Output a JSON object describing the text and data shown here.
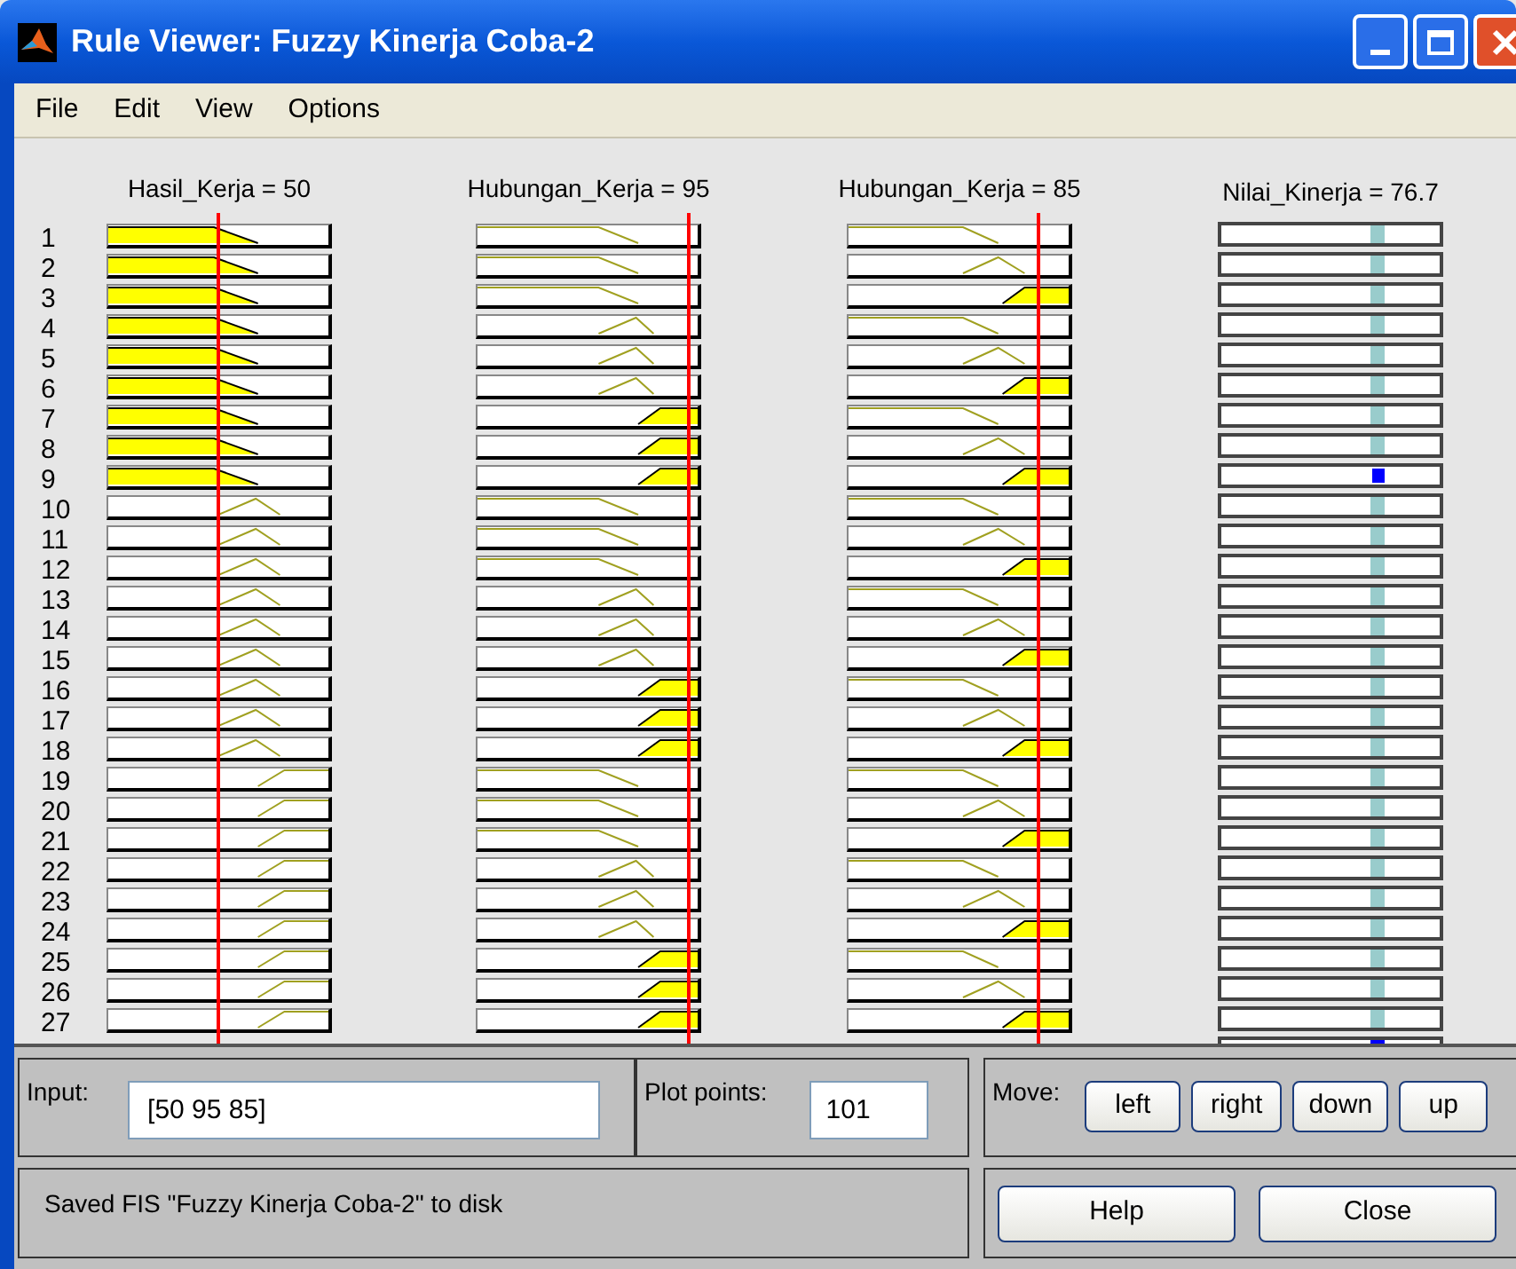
{
  "window": {
    "title": "Rule Viewer: Fuzzy Kinerja Coba-2"
  },
  "menu": [
    "File",
    "Edit",
    "View",
    "Options"
  ],
  "inputs": [
    {
      "label": "Hasil_Kerja = 50",
      "level": 0.49
    },
    {
      "label": "Hubungan_Kerja = 95",
      "level": 0.94
    },
    {
      "label": "Hubungan_Kerja = 85",
      "level": 0.84
    }
  ],
  "output": {
    "label": "Nilai_Kinerja = 76.7"
  },
  "rules": [
    {
      "number": "1",
      "cells": [
        {
          "kind": "low",
          "active": true
        },
        {
          "kind": "low",
          "active": false
        },
        {
          "kind": "low",
          "active": false
        }
      ],
      "output_active": false
    },
    {
      "number": "2",
      "cells": [
        {
          "kind": "low",
          "active": true
        },
        {
          "kind": "low",
          "active": false
        },
        {
          "kind": "mid",
          "active": false
        }
      ],
      "output_active": false
    },
    {
      "number": "3",
      "cells": [
        {
          "kind": "low",
          "active": true
        },
        {
          "kind": "low",
          "active": false
        },
        {
          "kind": "high",
          "active": true
        }
      ],
      "output_active": false
    },
    {
      "number": "4",
      "cells": [
        {
          "kind": "low",
          "active": true
        },
        {
          "kind": "mid",
          "active": false
        },
        {
          "kind": "low",
          "active": false
        }
      ],
      "output_active": false
    },
    {
      "number": "5",
      "cells": [
        {
          "kind": "low",
          "active": true
        },
        {
          "kind": "mid",
          "active": false
        },
        {
          "kind": "mid",
          "active": false
        }
      ],
      "output_active": false
    },
    {
      "number": "6",
      "cells": [
        {
          "kind": "low",
          "active": true
        },
        {
          "kind": "mid",
          "active": false
        },
        {
          "kind": "high",
          "active": true
        }
      ],
      "output_active": false
    },
    {
      "number": "7",
      "cells": [
        {
          "kind": "low",
          "active": true
        },
        {
          "kind": "high",
          "active": true
        },
        {
          "kind": "low",
          "active": false
        }
      ],
      "output_active": false
    },
    {
      "number": "8",
      "cells": [
        {
          "kind": "low",
          "active": true
        },
        {
          "kind": "high",
          "active": true
        },
        {
          "kind": "mid",
          "active": false
        }
      ],
      "output_active": false
    },
    {
      "number": "9",
      "cells": [
        {
          "kind": "low",
          "active": true
        },
        {
          "kind": "high",
          "active": true
        },
        {
          "kind": "high",
          "active": true
        }
      ],
      "output_active": true
    },
    {
      "number": "10",
      "cells": [
        {
          "kind": "mid",
          "active": false
        },
        {
          "kind": "low",
          "active": false
        },
        {
          "kind": "low",
          "active": false
        }
      ],
      "output_active": false
    },
    {
      "number": "11",
      "cells": [
        {
          "kind": "mid",
          "active": false
        },
        {
          "kind": "low",
          "active": false
        },
        {
          "kind": "mid",
          "active": false
        }
      ],
      "output_active": false
    },
    {
      "number": "12",
      "cells": [
        {
          "kind": "mid",
          "active": false
        },
        {
          "kind": "low",
          "active": false
        },
        {
          "kind": "high",
          "active": true
        }
      ],
      "output_active": false
    },
    {
      "number": "13",
      "cells": [
        {
          "kind": "mid",
          "active": false
        },
        {
          "kind": "mid",
          "active": false
        },
        {
          "kind": "low",
          "active": false
        }
      ],
      "output_active": false
    },
    {
      "number": "14",
      "cells": [
        {
          "kind": "mid",
          "active": false
        },
        {
          "kind": "mid",
          "active": false
        },
        {
          "kind": "mid",
          "active": false
        }
      ],
      "output_active": false
    },
    {
      "number": "15",
      "cells": [
        {
          "kind": "mid",
          "active": false
        },
        {
          "kind": "mid",
          "active": false
        },
        {
          "kind": "high",
          "active": true
        }
      ],
      "output_active": false
    },
    {
      "number": "16",
      "cells": [
        {
          "kind": "mid",
          "active": false
        },
        {
          "kind": "high",
          "active": true
        },
        {
          "kind": "low",
          "active": false
        }
      ],
      "output_active": false
    },
    {
      "number": "17",
      "cells": [
        {
          "kind": "mid",
          "active": false
        },
        {
          "kind": "high",
          "active": true
        },
        {
          "kind": "mid",
          "active": false
        }
      ],
      "output_active": false
    },
    {
      "number": "18",
      "cells": [
        {
          "kind": "mid",
          "active": false
        },
        {
          "kind": "high",
          "active": true
        },
        {
          "kind": "high",
          "active": true
        }
      ],
      "output_active": false
    },
    {
      "number": "19",
      "cells": [
        {
          "kind": "high",
          "active": false
        },
        {
          "kind": "low",
          "active": false
        },
        {
          "kind": "low",
          "active": false
        }
      ],
      "output_active": false
    },
    {
      "number": "20",
      "cells": [
        {
          "kind": "high",
          "active": false
        },
        {
          "kind": "low",
          "active": false
        },
        {
          "kind": "mid",
          "active": false
        }
      ],
      "output_active": false
    },
    {
      "number": "21",
      "cells": [
        {
          "kind": "high",
          "active": false
        },
        {
          "kind": "low",
          "active": false
        },
        {
          "kind": "high",
          "active": true
        }
      ],
      "output_active": false
    },
    {
      "number": "22",
      "cells": [
        {
          "kind": "high",
          "active": false
        },
        {
          "kind": "mid",
          "active": false
        },
        {
          "kind": "low",
          "active": false
        }
      ],
      "output_active": false
    },
    {
      "number": "23",
      "cells": [
        {
          "kind": "high",
          "active": false
        },
        {
          "kind": "mid",
          "active": false
        },
        {
          "kind": "mid",
          "active": false
        }
      ],
      "output_active": false
    },
    {
      "number": "24",
      "cells": [
        {
          "kind": "high",
          "active": false
        },
        {
          "kind": "mid",
          "active": false
        },
        {
          "kind": "high",
          "active": true
        }
      ],
      "output_active": false
    },
    {
      "number": "25",
      "cells": [
        {
          "kind": "high",
          "active": false
        },
        {
          "kind": "high",
          "active": true
        },
        {
          "kind": "low",
          "active": false
        }
      ],
      "output_active": false
    },
    {
      "number": "26",
      "cells": [
        {
          "kind": "high",
          "active": false
        },
        {
          "kind": "high",
          "active": true
        },
        {
          "kind": "mid",
          "active": false
        }
      ],
      "output_active": false
    },
    {
      "number": "27",
      "cells": [
        {
          "kind": "high",
          "active": false
        },
        {
          "kind": "high",
          "active": true
        },
        {
          "kind": "high",
          "active": true
        }
      ],
      "output_active": false
    }
  ],
  "input_field": {
    "label": "Input:",
    "value": "[50 95 85]"
  },
  "plot_points": {
    "label": "Plot points:",
    "value": "101"
  },
  "move": {
    "label": "Move:",
    "buttons": [
      "left",
      "right",
      "down",
      "up"
    ]
  },
  "status": "Saved FIS \"Fuzzy Kinerja Coba-2\" to disk",
  "buttons": [
    "Help",
    "Close"
  ]
}
